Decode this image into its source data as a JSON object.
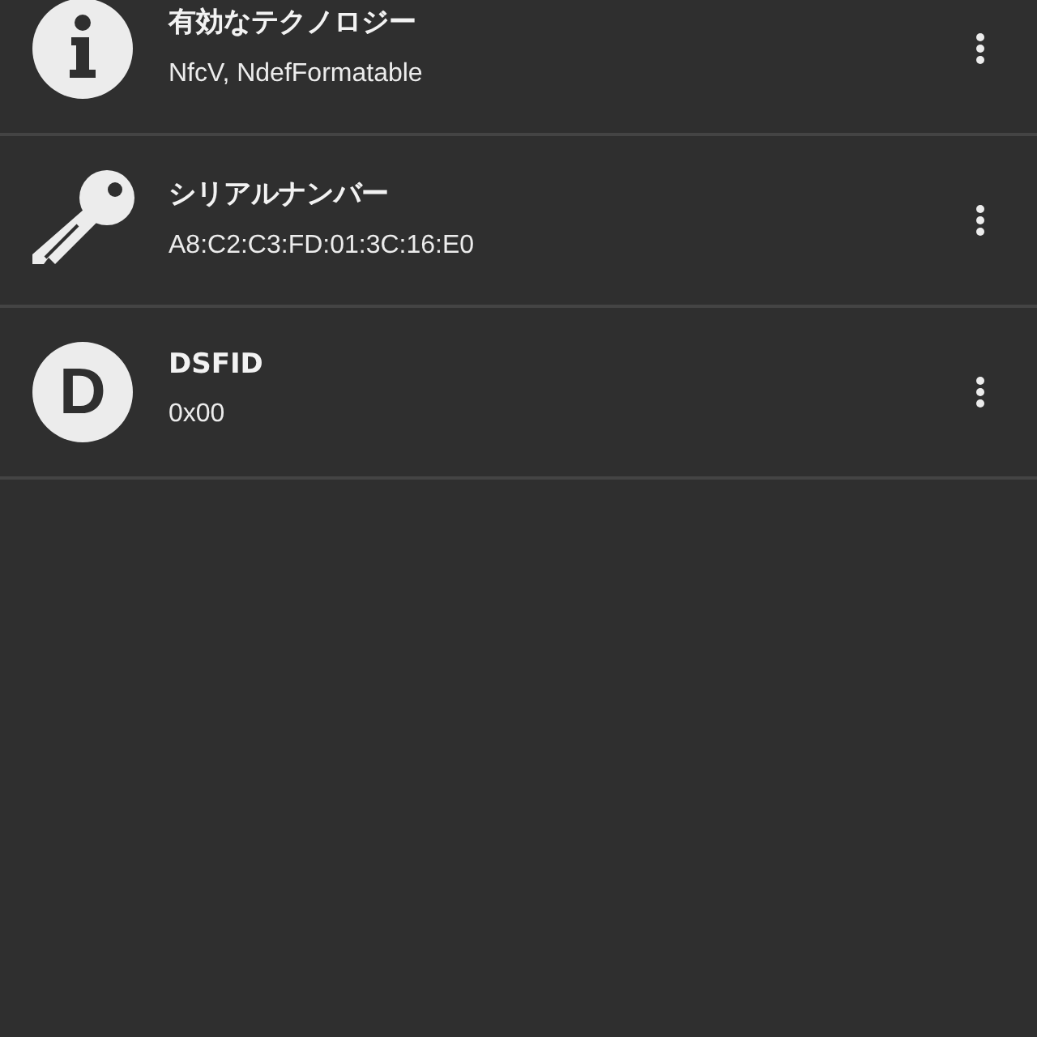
{
  "items": [
    {
      "kind": "info",
      "title": "有効なテクノロジー",
      "value": "NfcV, NdefFormatable"
    },
    {
      "kind": "key",
      "title": "シリアルナンバー",
      "value": "A8:C2:C3:FD:01:3C:16:E0"
    },
    {
      "kind": "letter",
      "letter": "D",
      "title": "DSFID",
      "value": "0x00"
    }
  ]
}
